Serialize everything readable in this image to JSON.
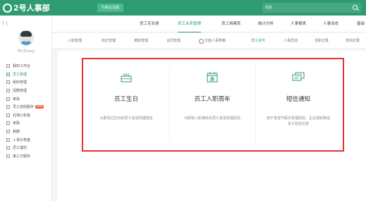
{
  "header": {
    "logo_text": "2号人事部",
    "upgrade_label": "升级企业版",
    "search_value": "短信",
    "accent_color": "#2f9b72"
  },
  "sidebar": {
    "user_name": "Mr.Zhang",
    "items": [
      {
        "label": "我的工作台",
        "icon": "home-icon",
        "active": false
      },
      {
        "label": "员工管理",
        "icon": "people-icon",
        "active": true
      },
      {
        "label": "组织管理",
        "icon": "org-icon",
        "active": false
      },
      {
        "label": "招聘管理",
        "icon": "recruit-icon",
        "active": false
      },
      {
        "label": "审批",
        "icon": "approval-icon",
        "active": false
      },
      {
        "label": "员工自助服务",
        "icon": "service-icon",
        "active": false,
        "badge": "NEW"
      },
      {
        "label": "社保公积金",
        "icon": "insurance-icon",
        "active": false
      },
      {
        "label": "考勤",
        "icon": "attendance-icon",
        "active": false
      },
      {
        "label": "薪酬",
        "icon": "salary-icon",
        "active": false
      },
      {
        "label": "人事仪表盘",
        "icon": "dashboard-icon",
        "active": false
      },
      {
        "label": "员工福利",
        "icon": "welfare-icon",
        "active": false
      },
      {
        "label": "第三方服务",
        "icon": "thirdparty-icon",
        "active": false
      }
    ]
  },
  "main_tabs": [
    {
      "label": "员工花名册",
      "active": false
    },
    {
      "label": "员工关系管理",
      "active": true
    },
    {
      "label": "员工档案库",
      "active": false
    },
    {
      "label": "统计分析",
      "active": false
    },
    {
      "label": "人事报表",
      "active": false
    },
    {
      "label": "人事动态",
      "active": false
    },
    {
      "label": "基础",
      "active": false
    }
  ],
  "sub_tabs": [
    {
      "label": "入职管理",
      "active": false
    },
    {
      "label": "转正管理",
      "active": false
    },
    {
      "label": "离职管理",
      "active": false
    },
    {
      "label": "合同管理",
      "active": false
    },
    {
      "label": "万能人事表格",
      "active": false,
      "icon": true
    },
    {
      "label": "员工关怀",
      "active": true
    },
    {
      "label": "人事异动",
      "active": false
    },
    {
      "label": "任职记录",
      "active": false
    },
    {
      "label": "培训记录",
      "active": false
    }
  ],
  "cards": [
    {
      "title": "员工生日",
      "desc": "为即将过生日的员工发送祝福短信",
      "icon": "cake-icon"
    },
    {
      "title": "员工入职周年",
      "desc": "为即将入职满年的员工发送祝福短信",
      "icon": "calendar-icon"
    },
    {
      "title": "短信通知",
      "desc": "用于发送节假日祝福短信、企业通知等自定义短信内容",
      "icon": "message-icon"
    }
  ]
}
